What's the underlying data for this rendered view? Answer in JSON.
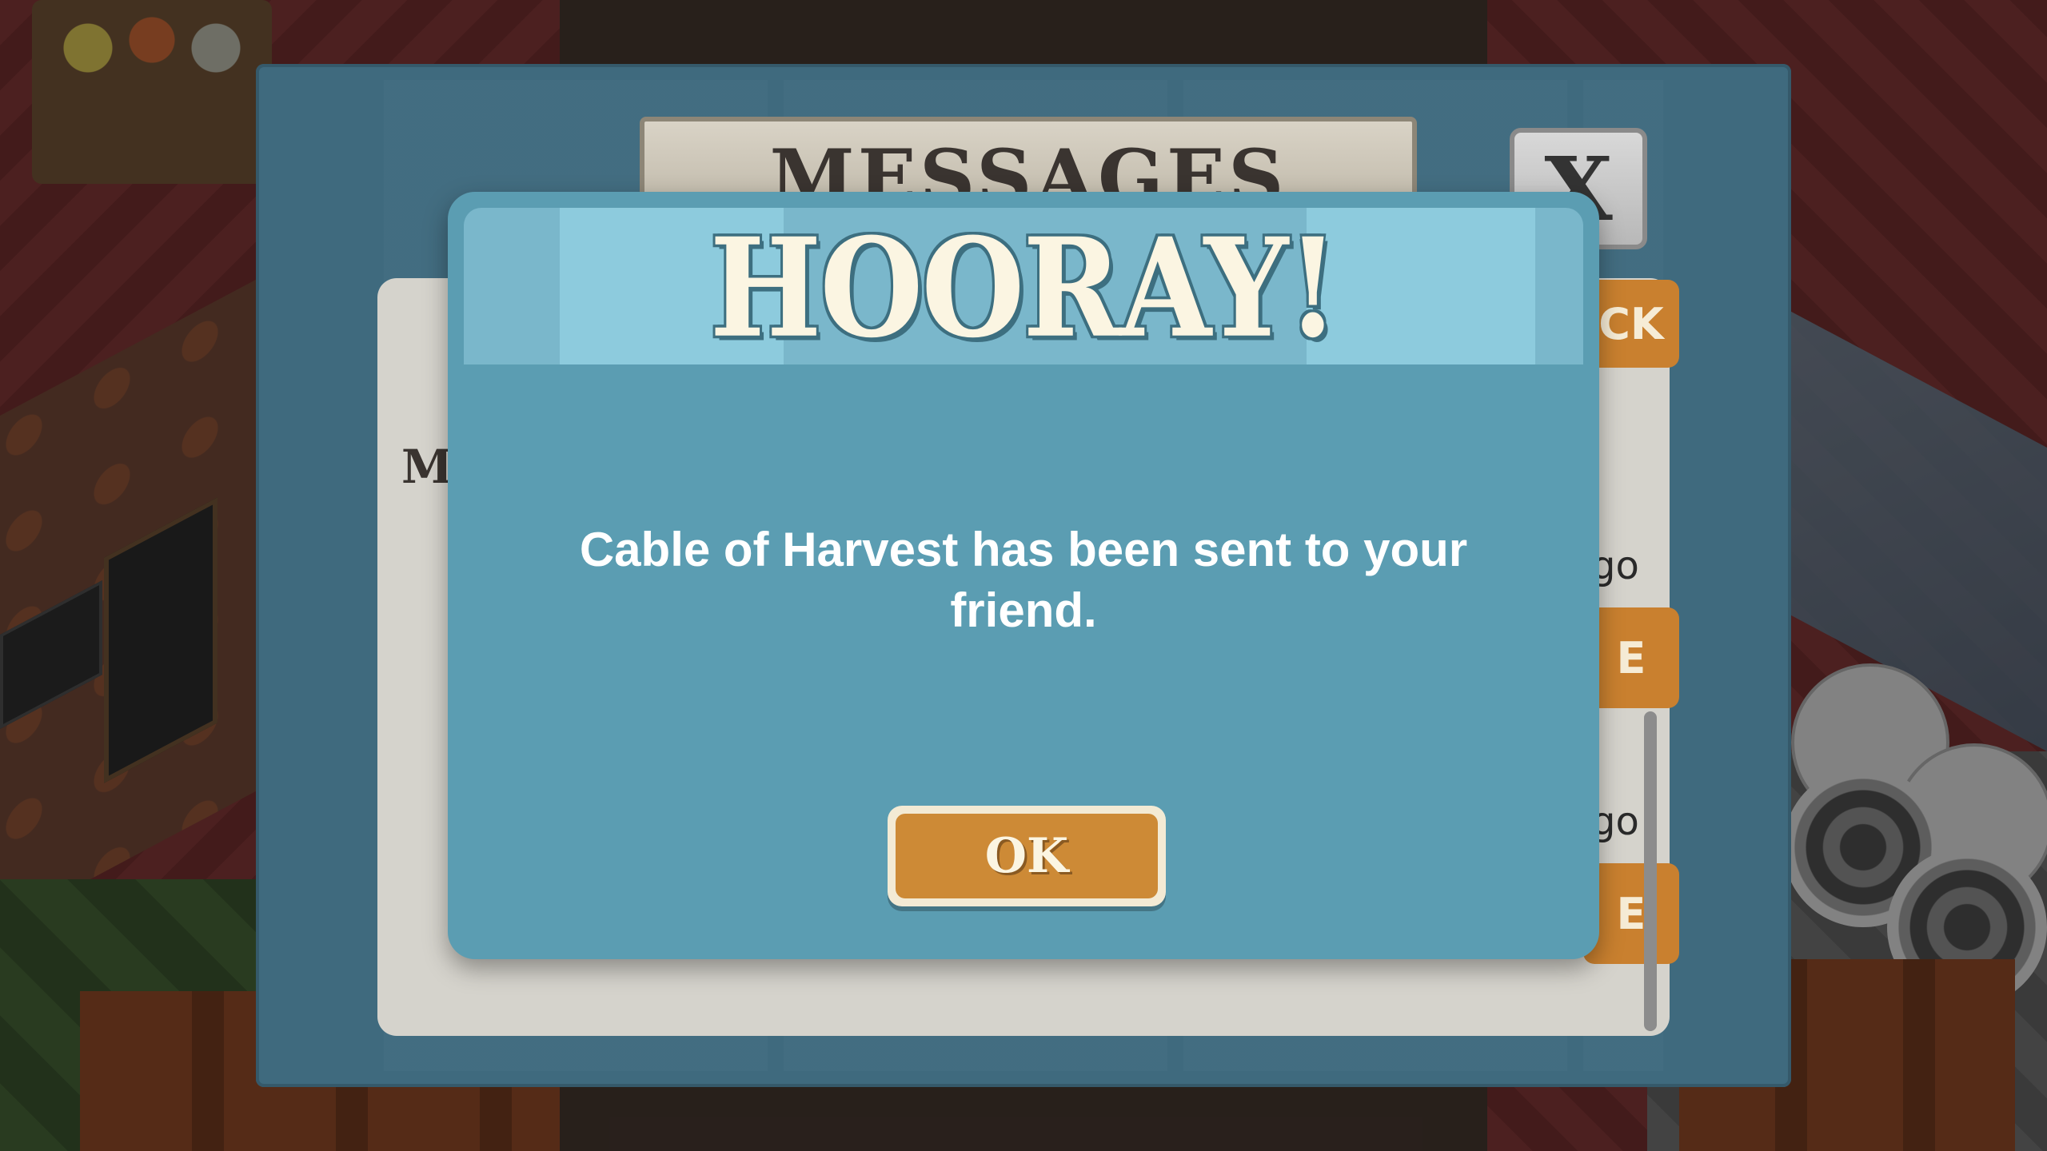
{
  "messages_panel": {
    "title": "MESSAGES",
    "close_label": "X",
    "side_label": "MA",
    "top_tab_label": "CK",
    "rows": [
      {
        "time": "go",
        "button_label": "E"
      },
      {
        "time": "go",
        "button_label": "E"
      }
    ]
  },
  "modal": {
    "title": "HOORAY!",
    "message": "Cable of Harvest has been sent to your friend.",
    "ok_label": "OK"
  },
  "colors": {
    "modal_bg": "#5b9db2",
    "modal_header": "#7ab7cb",
    "button_orange": "#cd8a36",
    "button_cream": "#f3ead4"
  }
}
